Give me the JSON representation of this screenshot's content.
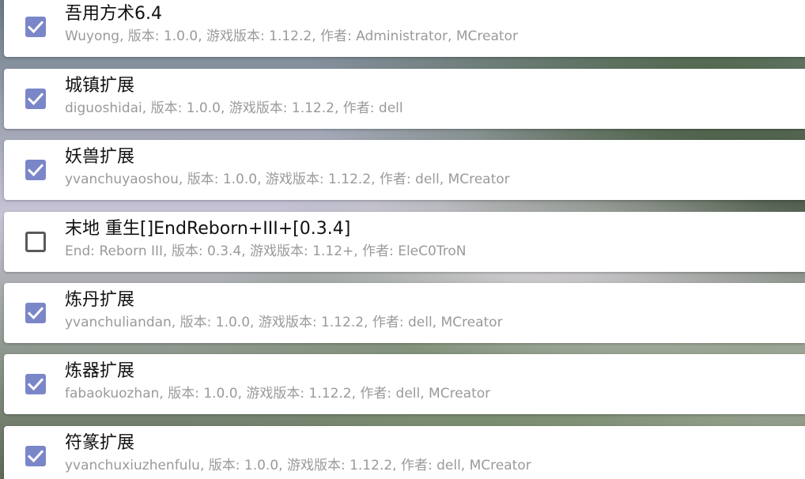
{
  "theme": {
    "checkbox_checked_color": "#7b86c9",
    "checkbox_unchecked_border": "#5a5a5a",
    "card_background": "#ffffff"
  },
  "mods": [
    {
      "title": "吾用方术6.4",
      "meta": "Wuyong, 版本: 1.0.0, 游戏版本: 1.12.2, 作者: Administrator, MCreator",
      "enabled": true
    },
    {
      "title": "城镇扩展",
      "meta": "diguoshidai, 版本: 1.0.0, 游戏版本: 1.12.2, 作者: dell",
      "enabled": true
    },
    {
      "title": "妖兽扩展",
      "meta": "yvanchuyaoshou, 版本: 1.0.0, 游戏版本: 1.12.2, 作者: dell, MCreator",
      "enabled": true
    },
    {
      "title": "末地 重生[]EndReborn+III+[0.3.4]",
      "meta": "End: Reborn III, 版本: 0.3.4, 游戏版本: 1.12+, 作者: EleC0TroN",
      "enabled": false
    },
    {
      "title": "炼丹扩展",
      "meta": "yvanchuliandan, 版本: 1.0.0, 游戏版本: 1.12.2, 作者: dell, MCreator",
      "enabled": true
    },
    {
      "title": "炼器扩展",
      "meta": "fabaokuozhan, 版本: 1.0.0, 游戏版本: 1.12.2, 作者: dell, MCreator",
      "enabled": true
    },
    {
      "title": "符篆扩展",
      "meta": "yvanchuxiuzhenfulu, 版本: 1.0.0, 游戏版本: 1.12.2, 作者: dell, MCreator",
      "enabled": true
    }
  ]
}
